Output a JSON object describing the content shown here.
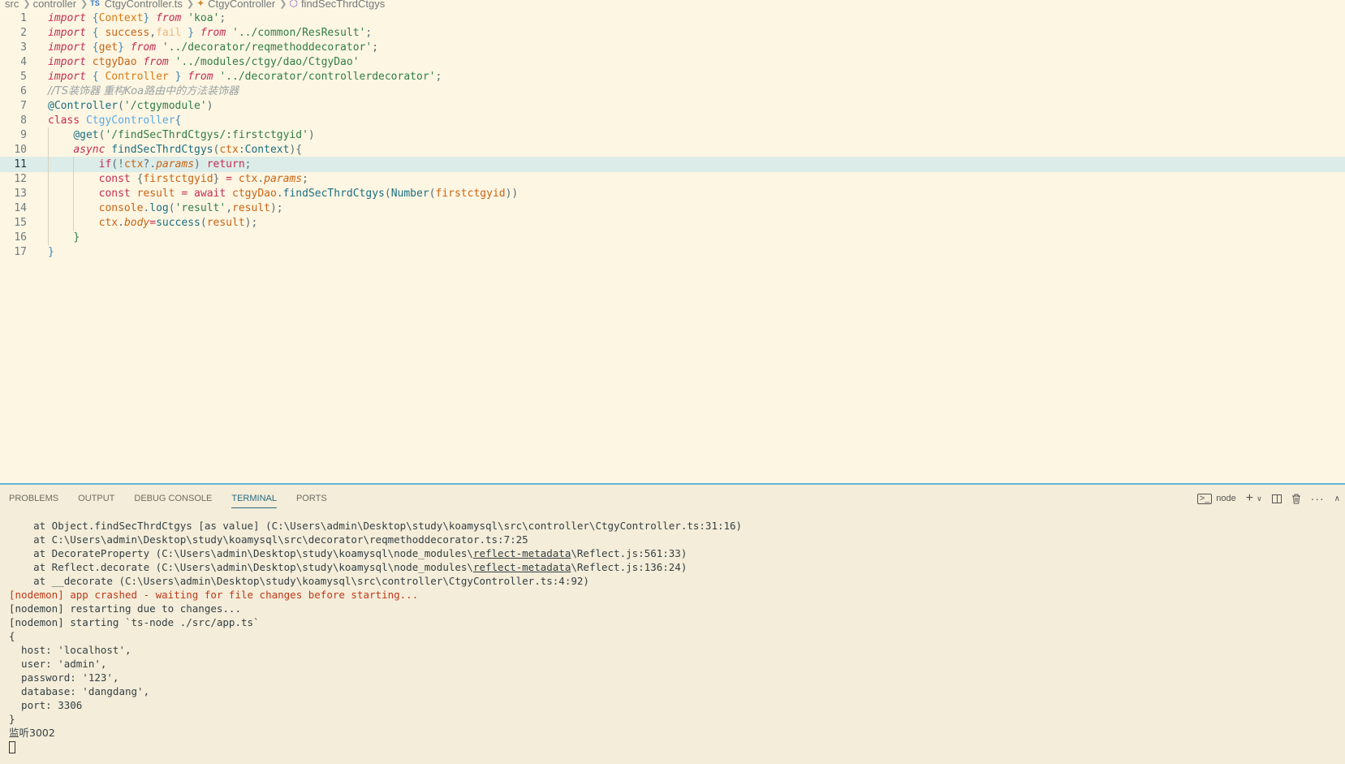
{
  "breadcrumb": {
    "items": [
      "src",
      "controller",
      "CtgyController.ts",
      "CtgyController",
      "findSecThrdCtgys"
    ],
    "ts_badge": "TS"
  },
  "editor": {
    "line_numbers": [
      "1",
      "2",
      "3",
      "4",
      "5",
      "6",
      "7",
      "8",
      "9",
      "10",
      "11",
      "12",
      "13",
      "14",
      "15",
      "16",
      "17"
    ],
    "active_line": 11,
    "lines": [
      "import {Context} from 'koa';",
      "import { success,fail } from '../common/ResResult';",
      "import {get} from '../decorator/reqmethoddecorator';",
      "import ctgyDao from '../modules/ctgy/dao/CtgyDao'",
      "import { Controller } from '../decorator/controllerdecorator';",
      "//TS装饰器 重构Koa路由中的方法装饰器",
      "@Controller('/ctgymodule')",
      "class CtgyController{",
      "    @get('/findSecThrdCtgys/:firstctgyid')",
      "    async findSecThrdCtgys(ctx:Context){",
      "        if(!ctx?.params) return;",
      "        const {firstctgyid} = ctx.params;",
      "        const result = await ctgyDao.findSecThrdCtgys(Number(firstctgyid))",
      "        console.log('result',result);",
      "        ctx.body=success(result);",
      "    }",
      "}"
    ]
  },
  "panel": {
    "tabs": [
      "PROBLEMS",
      "OUTPUT",
      "DEBUG CONSOLE",
      "TERMINAL",
      "PORTS"
    ],
    "active_tab": "TERMINAL",
    "terminal_name": "node"
  },
  "terminal": {
    "lines": [
      "    at Object.findSecThrdCtgys [as value] (C:\\Users\\admin\\Desktop\\study\\koamysql\\src\\controller\\CtgyController.ts:31:16)",
      "    at C:\\Users\\admin\\Desktop\\study\\koamysql\\src\\decorator\\reqmethoddecorator.ts:7:25",
      "    at DecorateProperty (C:\\Users\\admin\\Desktop\\study\\koamysql\\node_modules\\reflect-metadata\\Reflect.js:561:33)",
      "    at Reflect.decorate (C:\\Users\\admin\\Desktop\\study\\koamysql\\node_modules\\reflect-metadata\\Reflect.js:136:24)",
      "    at __decorate (C:\\Users\\admin\\Desktop\\study\\koamysql\\src\\controller\\CtgyController.ts:4:92)",
      "[nodemon] app crashed - waiting for file changes before starting...",
      "[nodemon] restarting due to changes...",
      "[nodemon] starting `ts-node ./src/app.ts`",
      "{",
      "  host: 'localhost',",
      "  user: 'admin',",
      "  password: '123',",
      "  database: 'dangdang',",
      "  port: 3306",
      "}",
      "监听3002"
    ]
  },
  "icons": {
    "terminal": "terminal-icon",
    "add": "plus-icon",
    "dropdown": "chevron-down-icon",
    "split": "split-terminal-icon",
    "kill": "trash-icon",
    "more": "ellipsis-icon",
    "maximize": "chevron-up-icon"
  },
  "colors": {
    "background": "#fdf6e3",
    "keyword": "#c42c54",
    "string": "#2f7e44",
    "active_line": "#dcece8",
    "panel_border": "#5fb6d8",
    "error": "#c0391a"
  }
}
